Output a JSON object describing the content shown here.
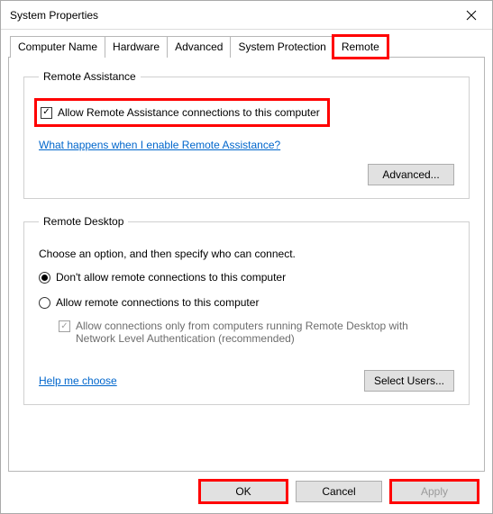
{
  "window": {
    "title": "System Properties"
  },
  "tabs": {
    "computer_name": "Computer Name",
    "hardware": "Hardware",
    "advanced": "Advanced",
    "system_protection": "System Protection",
    "remote": "Remote"
  },
  "remote_assistance": {
    "legend": "Remote Assistance",
    "allow_label": "Allow Remote Assistance connections to this computer",
    "link": "What happens when I enable Remote Assistance?",
    "advanced_btn": "Advanced..."
  },
  "remote_desktop": {
    "legend": "Remote Desktop",
    "choose_label": "Choose an option, and then specify who can connect.",
    "opt_dont_allow": "Don't allow remote connections to this computer",
    "opt_allow": "Allow remote connections to this computer",
    "nla_label": "Allow connections only from computers running Remote Desktop with Network Level Authentication (recommended)",
    "help_link": "Help me choose",
    "select_users_btn": "Select Users..."
  },
  "buttons": {
    "ok": "OK",
    "cancel": "Cancel",
    "apply": "Apply"
  }
}
